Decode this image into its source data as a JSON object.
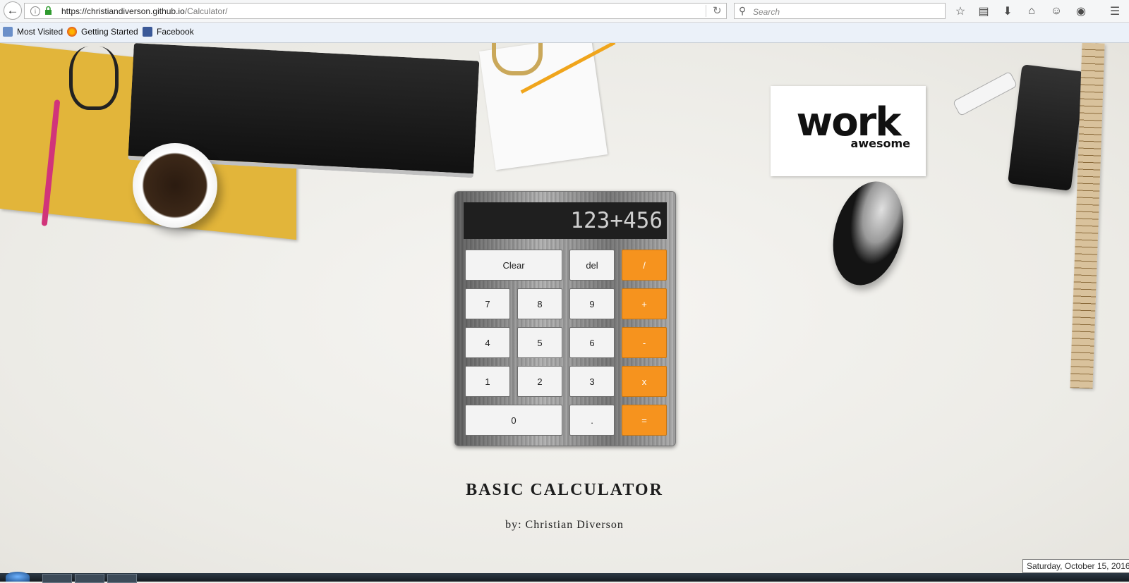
{
  "browser": {
    "url_host": "https://christiandiverson.github.io",
    "url_path": "/Calculator/",
    "search_placeholder": "Search",
    "bookmarks": [
      "Most Visited",
      "Getting Started",
      "Facebook"
    ]
  },
  "decor": {
    "card_big": "work",
    "card_small": "awesome"
  },
  "calculator": {
    "display": "123+456",
    "buttons": {
      "clear": "Clear",
      "del": "del",
      "divide": "/",
      "seven": "7",
      "eight": "8",
      "nine": "9",
      "plus": "+",
      "four": "4",
      "five": "5",
      "six": "6",
      "minus": "-",
      "one": "1",
      "two": "2",
      "three": "3",
      "times": "x",
      "zero": "0",
      "dot": ".",
      "equals": "="
    },
    "accent_color": "#f6931e"
  },
  "page": {
    "title": "BASIC CALCULATOR",
    "author": "by: Christian Diverson"
  },
  "taskbar": {
    "date_tooltip": "Saturday, October 15, 2016"
  }
}
